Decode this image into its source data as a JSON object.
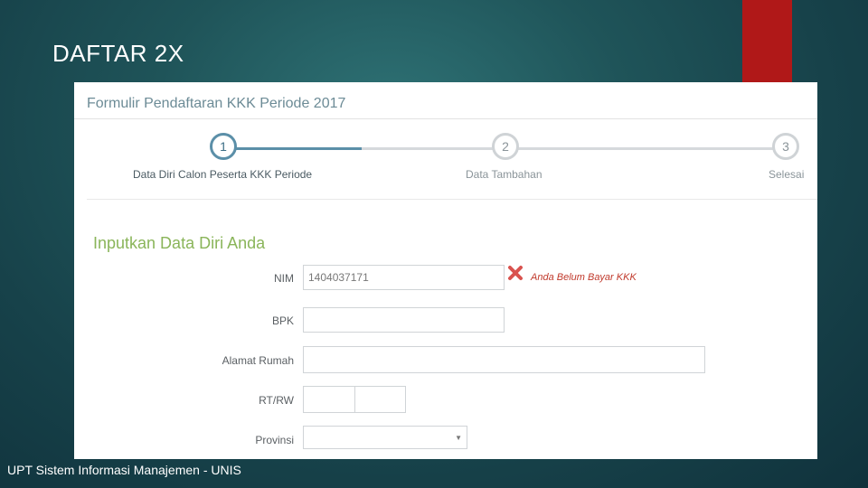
{
  "slide": {
    "title": "DAFTAR 2X",
    "footer": "UPT Sistem Informasi Manajemen - UNIS"
  },
  "form": {
    "header": "Formulir Pendaftaran KKK Periode 2017",
    "steps": [
      {
        "number": "1",
        "label": "Data Diri Calon Peserta KKK Periode"
      },
      {
        "number": "2",
        "label": "Data Tambahan"
      },
      {
        "number": "3",
        "label": "Selesai"
      }
    ],
    "section_title": "Inputkan Data Diri Anda",
    "fields": {
      "nim": {
        "label": "NIM",
        "value": "1404037171"
      },
      "bpk": {
        "label": "BPK",
        "value": ""
      },
      "alamat": {
        "label": "Alamat Rumah",
        "value": ""
      },
      "rtrw": {
        "label": "RT/RW",
        "rt_value": "",
        "rw_value": ""
      },
      "provinsi": {
        "label": "Provinsi",
        "selected": ""
      }
    },
    "error_message": "Anda Belum Bayar KKK"
  },
  "colors": {
    "accent_red": "#b01818",
    "step_active": "#5b8fa8",
    "section_green": "#8ab55a",
    "error_red": "#c0392b"
  }
}
